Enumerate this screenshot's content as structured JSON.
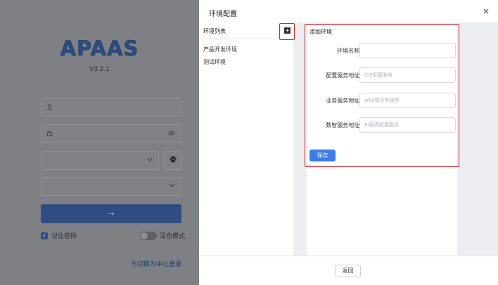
{
  "login": {
    "logo": "APAAS",
    "version": "V3.2.1",
    "user_icon": "user-icon",
    "lock_icon": "lock-icon",
    "eye_icon": "eye-off-icon",
    "login_arrow": "→",
    "remember_label": "记住密码",
    "dark_mode_label": "深色模式",
    "switch_link": "与切换为中心登录"
  },
  "dialog": {
    "title": "环境配置",
    "close": "×",
    "list_title": "环境列表",
    "add_symbol": "+",
    "environments": [
      "产品开发环境",
      "测试环境"
    ],
    "form": {
      "title": "添加环境",
      "fields": [
        {
          "label": "环境名称:",
          "value": "",
          "placeholder": ""
        },
        {
          "label": "配置服务地址:",
          "value": "",
          "placeholder": "IDE配置服务"
        },
        {
          "label": "业务服务地址:",
          "value": "",
          "placeholder": "web端业务服务"
        },
        {
          "label": "数智服务地址:",
          "value": "",
          "placeholder": "BI报表配置服务"
        }
      ],
      "save": "保存"
    },
    "back": "返回"
  },
  "colors": {
    "accent": "#3a7df0",
    "highlight": "#e02020"
  }
}
